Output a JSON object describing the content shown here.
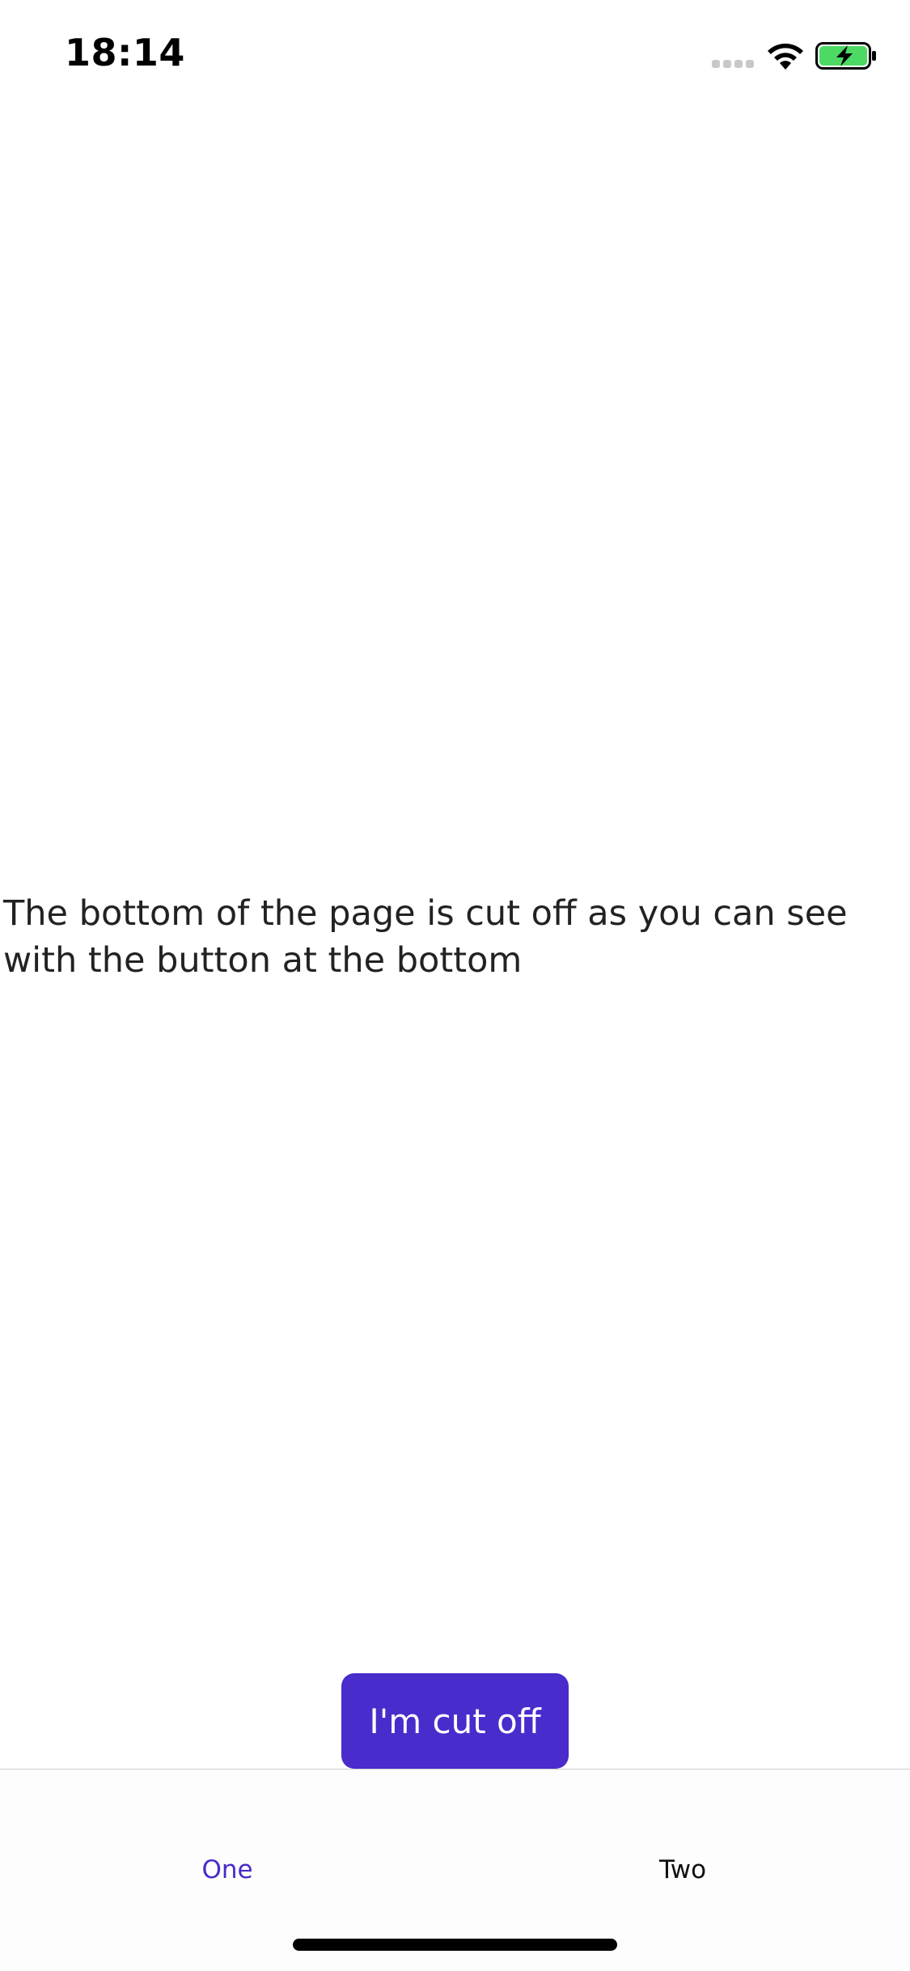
{
  "status_bar": {
    "time": "18:14",
    "signal_icon": "cellular-signal-icon",
    "wifi_icon": "wifi-icon",
    "battery_icon": "battery-charging-icon"
  },
  "main": {
    "message": "The bottom of the page is cut off as you can see with the button at the bottom",
    "button_label": "I'm cut off"
  },
  "tabs": [
    {
      "label": "One",
      "active": true
    },
    {
      "label": "Two",
      "active": false
    }
  ],
  "colors": {
    "accent": "#4a2bcb",
    "battery_fill": "#4cd964"
  }
}
